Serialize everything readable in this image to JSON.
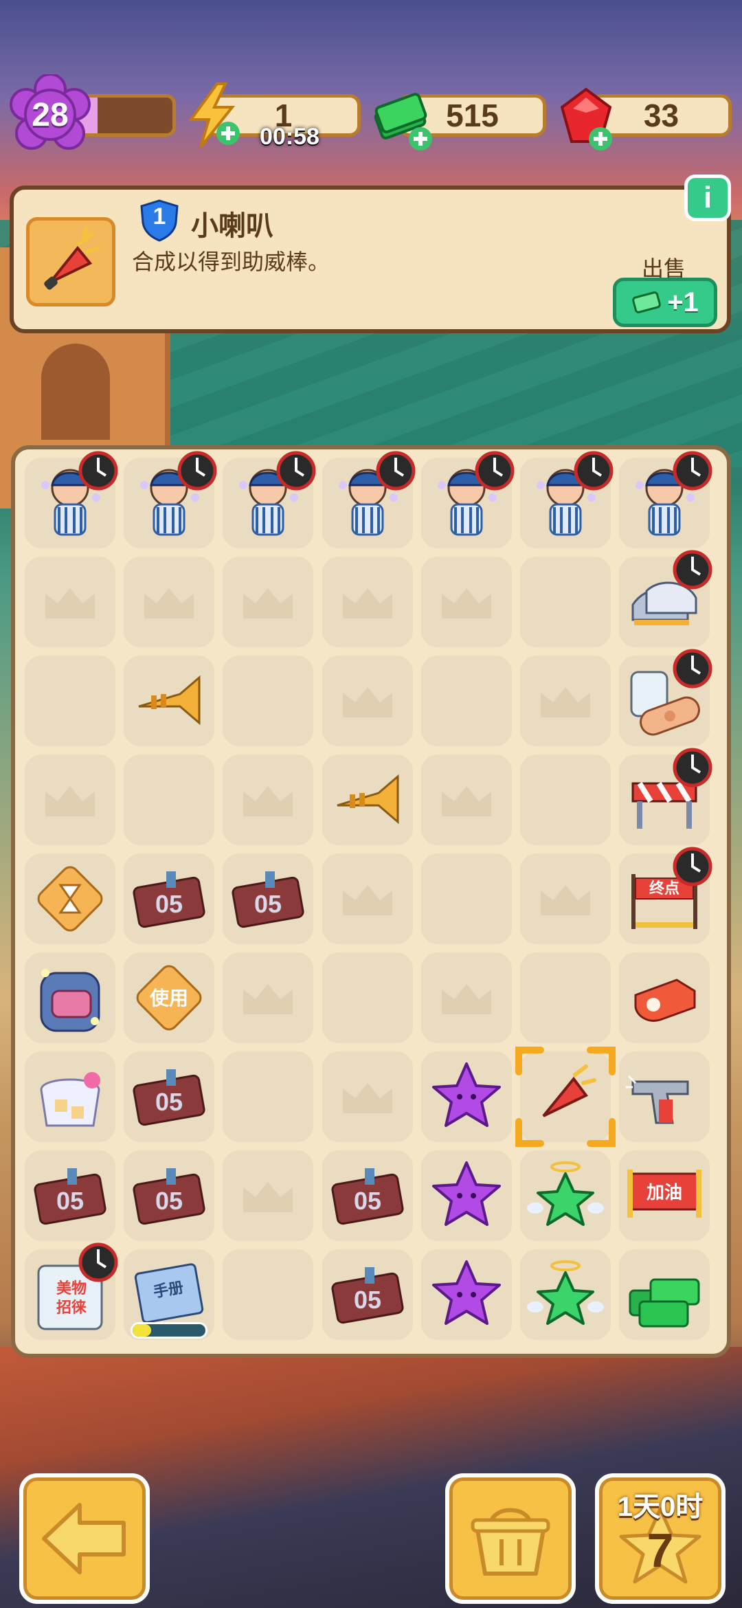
{
  "hud": {
    "level": "28",
    "xp_progress": 0.2,
    "energy": "1",
    "energy_timer": "00:58",
    "cash": "515",
    "gems": "33"
  },
  "info_panel": {
    "level": "1",
    "title": "小喇叭",
    "description": "合成以得到助威棒。",
    "sell_label": "出售",
    "sell_reward": "+1",
    "info_button": "i"
  },
  "board": {
    "rows": [
      [
        "cheerleader",
        "cheerleader",
        "cheerleader",
        "cheerleader",
        "cheerleader",
        "cheerleader",
        "cheerleader"
      ],
      [
        "empty",
        "empty",
        "empty",
        "empty",
        "empty",
        "blank",
        "sneakers"
      ],
      [
        "blank",
        "trumpet",
        "blank",
        "empty",
        "blank",
        "empty",
        "bandage"
      ],
      [
        "empty",
        "blank",
        "empty",
        "trumpet",
        "empty",
        "blank",
        "barrier"
      ],
      [
        "hourglass-token",
        "ticket",
        "ticket",
        "empty",
        "blank",
        "empty",
        "finish-line"
      ],
      [
        "backpack",
        "use-token",
        "empty",
        "blank",
        "empty",
        "blank",
        "whistle"
      ],
      [
        "sugar-bag",
        "ticket",
        "blank",
        "empty",
        "purple-star",
        "megaphone",
        "starter-pistol"
      ],
      [
        "ticket",
        "ticket",
        "empty",
        "ticket",
        "purple-star",
        "angel-star",
        "cheer-banner"
      ],
      [
        "gift-box",
        "manual",
        "blank",
        "ticket",
        "purple-star",
        "angel-star",
        "cash-pile"
      ]
    ],
    "selected": [
      6,
      5
    ],
    "timed_cells": [
      [
        0,
        0
      ],
      [
        0,
        1
      ],
      [
        0,
        2
      ],
      [
        0,
        3
      ],
      [
        0,
        4
      ],
      [
        0,
        5
      ],
      [
        0,
        6
      ],
      [
        1,
        6
      ],
      [
        2,
        6
      ],
      [
        3,
        6
      ],
      [
        4,
        6
      ],
      [
        8,
        0
      ]
    ],
    "manual_progress": 0.25,
    "labels": {
      "finish_line": "终点",
      "use_token": "使用",
      "ticket_number": "05",
      "manual": "手册",
      "gift_box": "美物招徕",
      "banner": "加油"
    }
  },
  "bottom": {
    "event_timer": "1天0时",
    "event_count": "7"
  },
  "colors": {
    "panel": "#f6e3bf",
    "accent_green": "#35c98a",
    "button_yellow": "#f7c145",
    "selection": "#f6a821"
  },
  "icons": {
    "back": "arrow-left-icon",
    "basket": "basket-icon",
    "star": "star-icon"
  }
}
